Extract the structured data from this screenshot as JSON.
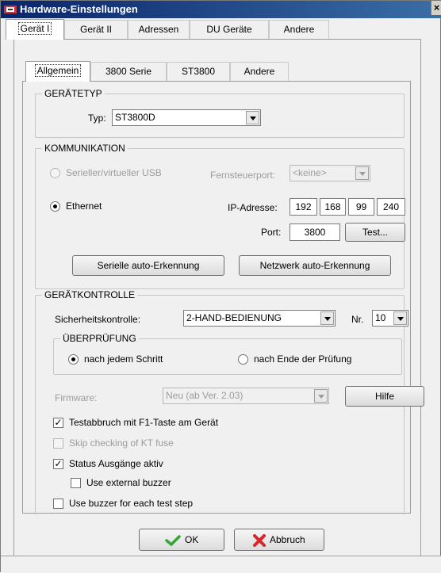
{
  "window": {
    "title": "Hardware-Einstellungen",
    "close": "×"
  },
  "main_tabs": [
    "Gerät I",
    "Gerät II",
    "Adressen",
    "DU Geräte",
    "Andere"
  ],
  "sub_tabs": [
    "Allgemein",
    "3800 Serie",
    "ST3800",
    "Andere"
  ],
  "geraetetyp": {
    "legend": "GERÄTETYP",
    "typ_label": "Typ:",
    "typ_value": "ST3800D"
  },
  "kommunikation": {
    "legend": "KOMMUNIKATION",
    "seriell_label": "Serieller/virtueller USB",
    "fernsteuerport_label": "Fernsteuerport:",
    "fernsteuerport_value": "<keine>",
    "ethernet_label": "Ethernet",
    "ip_label": "IP-Adresse:",
    "ip": [
      "192",
      "168",
      "99",
      "240"
    ],
    "port_label": "Port:",
    "port_value": "3800",
    "test_button": "Test...",
    "seriell_auto_button": "Serielle auto-Erkennung",
    "netzwerk_auto_button": "Netzwerk auto-Erkennung"
  },
  "geraetekontrolle": {
    "legend": "GERÄTKONTROLLE",
    "sicherheit_label": "Sicherheitskontrolle:",
    "sicherheit_value": "2-HAND-BEDIENUNG",
    "nr_label": "Nr.",
    "nr_value": "10",
    "ueberpruefung_legend": "ÜBERPRÜFUNG",
    "radio_jedem": "nach jedem Schritt",
    "radio_ende": "nach Ende der Prüfung",
    "firmware_label": "Firmware:",
    "firmware_value": "Neu (ab Ver. 2.03)",
    "hilfe_button": "Hilfe",
    "check_testabbruch": "Testabbruch mit F1-Taste am Gerät",
    "check_skip": "Skip checking of KT fuse",
    "check_status": "Status Ausgänge aktiv",
    "check_external": "Use external buzzer",
    "check_buzzer_each": "Use buzzer for each test step"
  },
  "buttons": {
    "ok": "OK",
    "abbruch": "Abbruch"
  },
  "colors": {
    "titlebar": "#0a246a",
    "ok_check": "#3aa335",
    "cancel_x": "#d9262b"
  }
}
